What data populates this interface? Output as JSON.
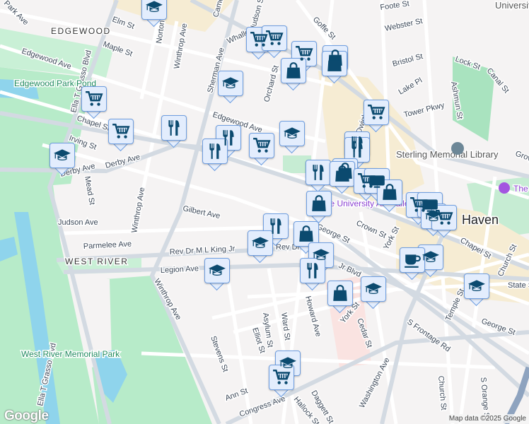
{
  "map": {
    "neighborhoods": [
      "EDGEWOOD",
      "WEST RIVER"
    ],
    "city_label": "Haven",
    "parks": [
      "Edgewood Park Pond",
      "West River Memorial Park"
    ],
    "poi": [
      "Sterling Memorial Library",
      "Yale University Art Gallery",
      "The",
      "University Science"
    ],
    "streets": [
      "Park Ave",
      "Elm St",
      "Maple St",
      "Edgewood Ave",
      "Norton St",
      "Winthrop Ave",
      "Cameron",
      "Sherman Ave",
      "Ella T Grasso Blvd",
      "Chapel St",
      "Irving St",
      "Derby Ave",
      "Derby Ave",
      "Mead St",
      "Winthrop Ave",
      "Judson Ave",
      "Gilbert Ave",
      "Parmelee Ave",
      "Rev Dr M L King Jr",
      "Legion Ave",
      "Winthrop Ave",
      "Stevens St",
      "Elliot St",
      "Asylum St",
      "Ward St",
      "Ann St",
      "Congress Ave",
      "Hallock St",
      "Daggett St",
      "Washington Ave",
      "Cedar St",
      "York St",
      "S Frontage Rd",
      "Church St",
      "S Orange St",
      "George St",
      "Temple St",
      "State St",
      "Church St",
      "Chapel St",
      "Crown St",
      "York St",
      "George St",
      "Jr Blvd",
      "Rev Dr",
      "Goffe St",
      "Foote St",
      "Webster St",
      "Bristol St",
      "Lock St",
      "Canal St",
      "Lake Pl",
      "Tower Pkwy",
      "Ashmun St",
      "Orchard St",
      "Edgewood Ave",
      "Whalley",
      "Dwight St",
      "Hudson St",
      "Howard Ave",
      "Grove",
      "Ella T Grasso Blvd"
    ]
  },
  "markers": [
    "education",
    "cart",
    "cart",
    "cart",
    "bag",
    "bag",
    "bag",
    "education",
    "cart",
    "cart",
    "restaurant",
    "restaurant",
    "restaurant",
    "cart",
    "education",
    "education",
    "cart",
    "restaurant",
    "restaurant",
    "restaurant",
    "bag",
    "bag",
    "cart",
    "tv",
    "bag",
    "bag",
    "cart",
    "tv",
    "education",
    "cart",
    "restaurant",
    "bag",
    "education",
    "education",
    "restaurant",
    "education",
    "coffee",
    "education",
    "bag",
    "education",
    "education",
    "cart",
    "education"
  ],
  "colors": {
    "marker_bg": "#e3edfd",
    "marker_border": "#6f9ee0",
    "icon": "#0b4a6f",
    "park": "#b7ebc9",
    "water": "#8fd4ec",
    "campus": "#f6ecd3"
  },
  "footer": {
    "logo": "Google",
    "attribution": "Map data ©2025 Google"
  }
}
